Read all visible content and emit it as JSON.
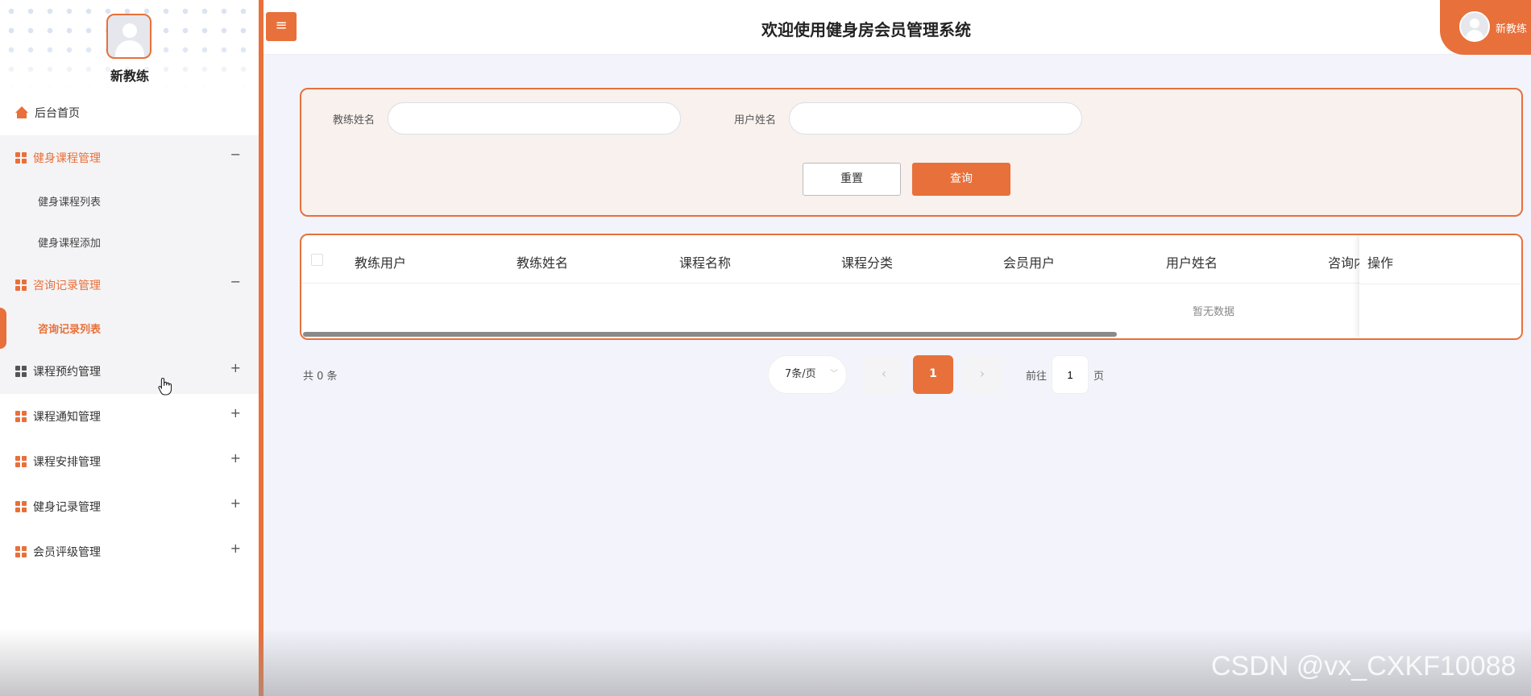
{
  "sidebar": {
    "username": "新教练",
    "home": "后台首页",
    "groups": [
      {
        "label": "健身课程管理",
        "toggle": "−",
        "sub": [
          "健身课程列表",
          "健身课程添加"
        ]
      },
      {
        "label": "咨询记录管理",
        "toggle": "−",
        "sub": [
          "咨询记录列表"
        ]
      },
      {
        "label": "课程预约管理",
        "toggle": "+"
      },
      {
        "label": "课程通知管理",
        "toggle": "+"
      },
      {
        "label": "课程安排管理",
        "toggle": "+"
      },
      {
        "label": "健身记录管理",
        "toggle": "+"
      },
      {
        "label": "会员评级管理",
        "toggle": "+"
      }
    ]
  },
  "header": {
    "menu_icon": "≡",
    "title": "欢迎使用健身房会员管理系统",
    "user": "新教练"
  },
  "search": {
    "coach_label": "教练姓名",
    "coach_value": "",
    "user_label": "用户姓名",
    "user_value": "",
    "reset": "重置",
    "query": "查询"
  },
  "table": {
    "columns": [
      "教练用户",
      "教练姓名",
      "课程名称",
      "课程分类",
      "会员用户",
      "用户姓名",
      "咨询内"
    ],
    "action_column": "操作",
    "empty": "暂无数据"
  },
  "pagination": {
    "total": "共 0 条",
    "page_size": "7条/页",
    "prev": "‹",
    "current": "1",
    "next": "›",
    "goto_prefix": "前往",
    "goto_value": "1",
    "goto_suffix": "页"
  },
  "watermark": "CSDN @vx_CXKF10088",
  "colors": {
    "accent": "#e8703a",
    "background": "#f3f4fb"
  }
}
